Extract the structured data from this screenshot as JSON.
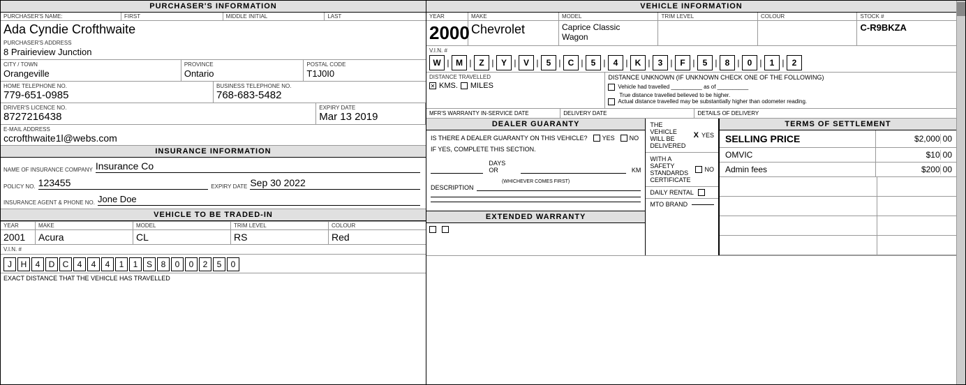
{
  "headers": {
    "purchaser_info": "PURCHASER'S INFORMATION",
    "vehicle_info": "VEHICLE INFORMATION",
    "insurance_info": "INSURANCE INFORMATION",
    "dealer_guaranty": "DEALER GUARANTY",
    "terms_of_settlement": "TERMS OF SETTLEMENT",
    "vehicle_trade": "VEHICLE TO BE TRADED-IN",
    "extended_warranty": "EXTENDED WARRANTY"
  },
  "purchaser": {
    "name_label": "PURCHASER'S NAME:",
    "first_label": "FIRST",
    "middle_label": "MIDDLE INITIAL",
    "last_label": "LAST",
    "full_name": "Ada Cyndie Crofthwaite",
    "address_label": "PURCHASER'S ADDRESS",
    "address": "8 Prairieview Junction",
    "city_label": "CITY / TOWN",
    "city": "Orangeville",
    "province_label": "PROVINCE",
    "province": "Ontario",
    "postal_label": "POSTAL CODE",
    "postal": "T1J0I0",
    "home_phone_label": "HOME TELEPHONE No.",
    "home_phone": "779-651-0985",
    "biz_phone_label": "BUSINESS TELEPHONE No.",
    "biz_phone": "768-683-5482",
    "licence_label": "DRIVER'S LICENCE No.",
    "licence": "8727216438",
    "expiry_label": "EXPIRY DATE",
    "expiry": "Mar 13 2019",
    "email_label": "E-MAIL ADDRESS",
    "email": "ccrofthwaite1l@webs.com"
  },
  "insurance": {
    "company_label": "NAME OF INSURANCE COMPANY",
    "company": "Insurance Co",
    "policy_label": "POLICY NO.",
    "policy": "123455",
    "expiry_label": "EXPIRY DATE",
    "expiry": "Sep 30 2022",
    "agent_label": "INSURANCE AGENT & PHONE NO.",
    "agent": "Jone Doe"
  },
  "trade_vehicle": {
    "year_label": "YEAR",
    "make_label": "MAKE",
    "model_label": "MODEL",
    "trim_label": "TRIM LEVEL",
    "colour_label": "COLOUR",
    "year": "2001",
    "make": "Acura",
    "model": "CL",
    "trim": "RS",
    "colour": "Red",
    "vin_label": "V.I.N. #",
    "vin_chars": [
      "J",
      "H",
      "4",
      "D",
      "C",
      "4",
      "4",
      "4",
      "1",
      "1",
      "S",
      "8",
      "0",
      "0",
      "2",
      "5",
      "0"
    ],
    "exact_dist_label": "EXACT DISTANCE THAT THE VEHICLE HAS TRAVELLED"
  },
  "vehicle": {
    "year_label": "YEAR",
    "make_label": "MAKE",
    "model_label": "MODEL",
    "trim_label": "TRIM LEVEL",
    "colour_label": "COLOUR",
    "stock_label": "STOCK #",
    "year": "2000",
    "make": "Chevrolet",
    "model": "Caprice Classic",
    "model_line2": "Wagon",
    "trim": "",
    "colour": "",
    "stock": "C-R9BKZA",
    "vin_label": "V.I.N. #",
    "vin_chars": [
      "W",
      "M",
      "Z",
      "Y",
      "V",
      "5",
      "C",
      "5",
      "4",
      "K",
      "3",
      "F",
      "5",
      "8",
      "0",
      "1",
      "2"
    ],
    "vin_separators": [
      "|",
      "|",
      "|",
      "|",
      "|",
      "|",
      "|",
      "|",
      "|",
      "|",
      "|",
      "|",
      "|",
      "|",
      "|",
      "|"
    ],
    "dist_label": "DISTANCE TRAVELLED",
    "kms_label": "KMS.",
    "miles_label": "MILES",
    "kms_checked": true,
    "dist_unknown_label": "DISTANCE UNKNOWN (if unknown check one of the following)",
    "dist_option1": "Vehicle had travelled __________ as of __________",
    "dist_option1b": "True distance travelled believed to be higher.",
    "dist_option2": "Actual distance travelled may be substantially higher than odometer reading.",
    "warranty_label": "MFR'S WARRANTY IN-SERVICE DATE",
    "delivery_label": "DELIVERY DATE",
    "details_label": "DETAILS OF DELIVERY",
    "delivered_label": "THE VEHICLE WILL BE DELIVERED",
    "yes_label": "YES",
    "no_label": "NO",
    "daily_rental_label": "DAILY RENTAL",
    "mto_brand_label": "MTO BRAND",
    "safety_label": "WITH A SAFETY STANDARDS CERTIFICATE"
  },
  "guaranty": {
    "question": "IS THERE A DEALER GUARANTY ON THIS VEHICLE?",
    "yes_label": "YES",
    "no_label": "NO",
    "complete": "IF YES, COMPLETE THIS SECTION.",
    "days_label": "DAYS OR",
    "km_label": "KM",
    "whichever": "(WHICHEVER COMES FIRST)",
    "desc_label": "DESCRIPTION"
  },
  "terms": {
    "selling_price_label": "SELLING PRICE",
    "selling_price": "$2,000",
    "selling_cents": "00",
    "omvic_label": "OMVIC",
    "omvic_amount": "$10",
    "omvic_cents": "00",
    "admin_label": "Admin fees",
    "admin_amount": "$200",
    "admin_cents": "00"
  }
}
